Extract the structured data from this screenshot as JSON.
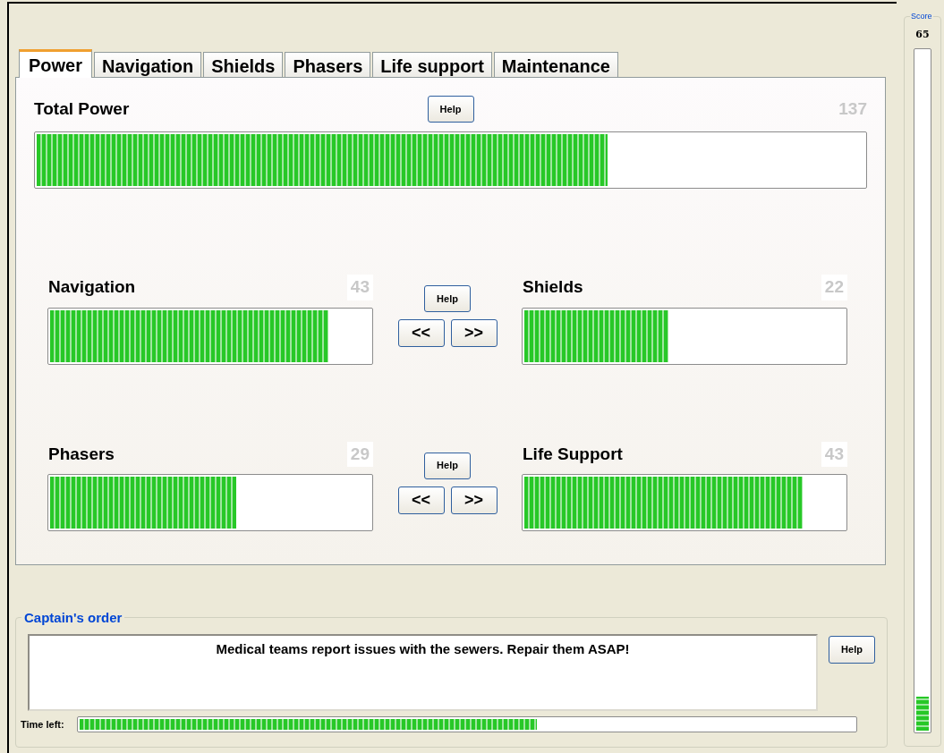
{
  "tabs": [
    {
      "label": "Power",
      "selected": true
    },
    {
      "label": "Navigation",
      "selected": false
    },
    {
      "label": "Shields",
      "selected": false
    },
    {
      "label": "Phasers",
      "selected": false
    },
    {
      "label": "Life support",
      "selected": false
    },
    {
      "label": "Maintenance",
      "selected": false
    }
  ],
  "total_power": {
    "title": "Total Power",
    "value": "137",
    "level": 0.69,
    "help": "Help"
  },
  "subsystem_pairs": [
    {
      "left": {
        "name": "Navigation",
        "value": "43",
        "level": 0.87
      },
      "right": {
        "name": "Shields",
        "value": "22",
        "level": 0.45
      },
      "help": "Help",
      "buttons": [
        "<<",
        ">>"
      ]
    },
    {
      "left": {
        "name": "Phasers",
        "value": "29",
        "level": 0.58
      },
      "right": {
        "name": "Life Support",
        "value": "43",
        "level": 0.87
      },
      "help": "Help",
      "buttons": [
        "<<",
        ">>"
      ]
    }
  ],
  "captains_order": {
    "legend": "Captain's order",
    "message": "Medical teams report issues with the sewers. Repair them ASAP!",
    "help": "Help",
    "time_left": {
      "label": "Time left:",
      "level": 0.59
    }
  },
  "score": {
    "legend": "Score",
    "value": "65",
    "level": 0.05
  }
}
